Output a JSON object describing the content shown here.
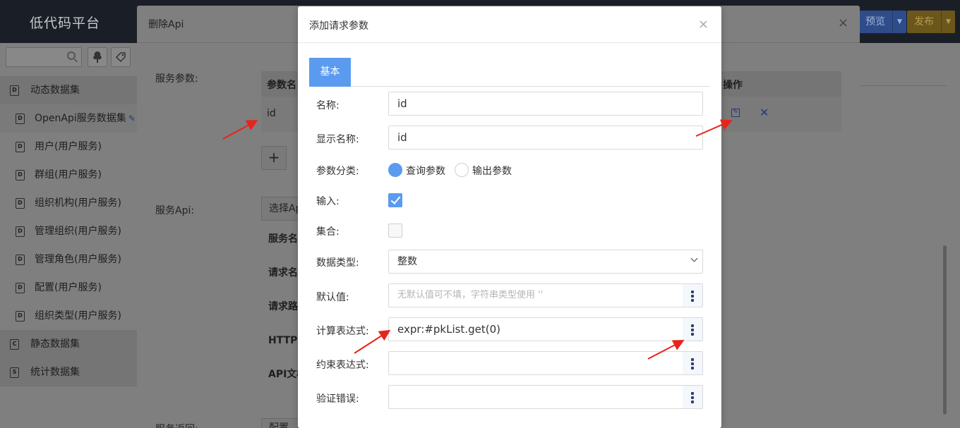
{
  "app": {
    "title": "低代码平台"
  },
  "toolbar": {
    "preview_label": "预览",
    "publish_label": "发布"
  },
  "sidebar": {
    "search_placeholder": "",
    "items": [
      {
        "label": "动态数据集",
        "icon": "D",
        "type": "group"
      },
      {
        "label": "OpenApi服务数据集",
        "icon": "D",
        "type": "child",
        "active": true
      },
      {
        "label": "用户(用户服务)",
        "icon": "D",
        "type": "child"
      },
      {
        "label": "群组(用户服务)",
        "icon": "D",
        "type": "child"
      },
      {
        "label": "组织机构(用户服务)",
        "icon": "D",
        "type": "child"
      },
      {
        "label": "管理组织(用户服务)",
        "icon": "D",
        "type": "child"
      },
      {
        "label": "管理角色(用户服务)",
        "icon": "D",
        "type": "child"
      },
      {
        "label": "配置(用户服务)",
        "icon": "D",
        "type": "child"
      },
      {
        "label": "组织类型(用户服务)",
        "icon": "D",
        "type": "child"
      },
      {
        "label": "静态数据集",
        "icon": "C",
        "type": "group"
      },
      {
        "label": "统计数据集",
        "icon": "S",
        "type": "group"
      }
    ]
  },
  "bg_modal": {
    "title": "删除Api",
    "service_params_label": "服务参数:",
    "table_headers": [
      "参数名",
      "操作"
    ],
    "table_rows": [
      {
        "name": "id"
      }
    ],
    "service_api_label": "服务Api:",
    "select_api_button": "选择Api",
    "fields": [
      "服务名",
      "请求名",
      "请求路",
      "HTTP方",
      "API文档"
    ],
    "service_return_label": "服务返回:",
    "config_button": "配置"
  },
  "dialog": {
    "title": "添加请求参数",
    "tab_basic": "基本",
    "name_label": "名称:",
    "name_value": "id",
    "display_name_label": "显示名称:",
    "display_name_value": "id",
    "param_category_label": "参数分类:",
    "radio_query": "查询参数",
    "radio_output": "输出参数",
    "input_label": "输入:",
    "input_checked": true,
    "collection_label": "集合:",
    "collection_checked": false,
    "data_type_label": "数据类型:",
    "data_type_value": "整数",
    "default_label": "默认值:",
    "default_placeholder": "无默认值可不填，字符串类型使用 ''",
    "calc_expr_label": "计算表达式:",
    "calc_expr_value": "expr:#pkList.get(0)",
    "constraint_expr_label": "约束表达式:",
    "constraint_expr_value": "",
    "validation_error_label": "验证错误:",
    "validation_error_value": ""
  },
  "colors": {
    "accent": "#5b9bef",
    "annotation": "#e8231a"
  }
}
